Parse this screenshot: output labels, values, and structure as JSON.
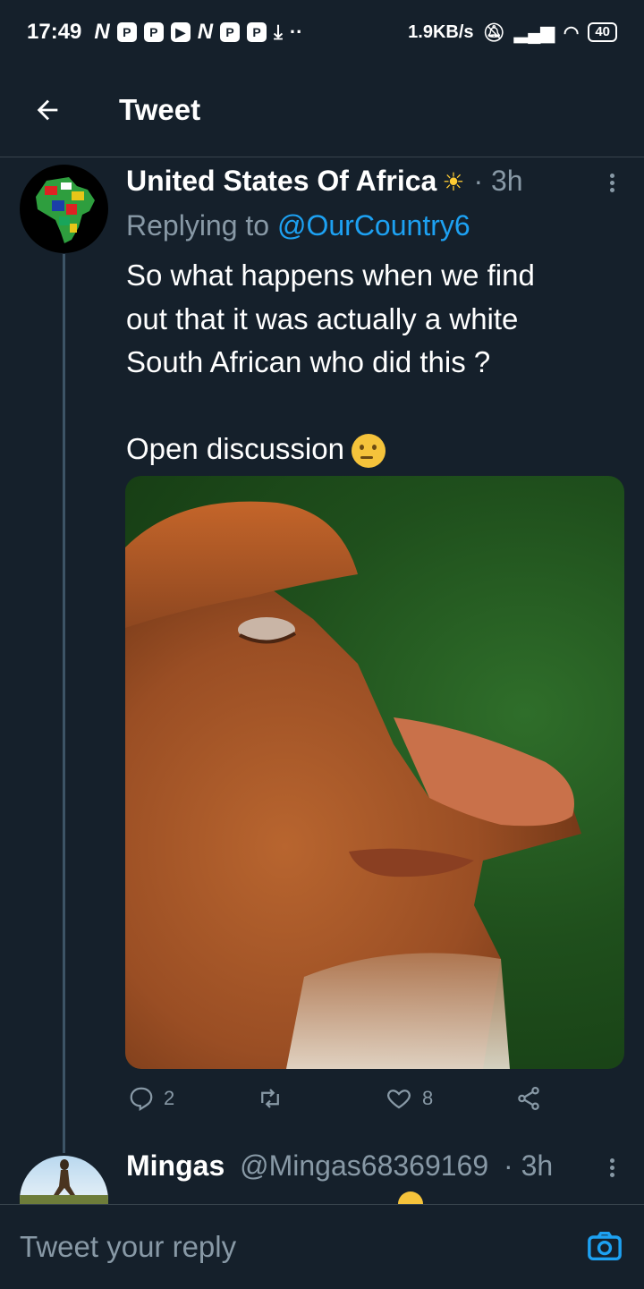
{
  "status_bar": {
    "time": "17:49",
    "network_speed": "1.9KB/s",
    "battery": "40",
    "dots": "··"
  },
  "header": {
    "title": "Tweet"
  },
  "tweet": {
    "author_name": "United States Of Africa",
    "author_emoji": "☀",
    "time": "· 3h",
    "replying_to_prefix": "Replying to ",
    "replying_to_handle": "@OurCountry6",
    "body_line1": "So what happens when we find",
    "body_line2": "out that it was actually a white",
    "body_line3": "South African who did this ?",
    "body_line4": "Open discussion",
    "reply_count": "2",
    "like_count": "8"
  },
  "next_tweet": {
    "author_name": "Mingas",
    "handle": "@Mingas68369169",
    "time": "· 3h"
  },
  "reply_bar": {
    "placeholder": "Tweet your reply"
  },
  "colors": {
    "background": "#15202b",
    "link": "#1da1f2",
    "muted": "#8899a6",
    "divider": "#38444d"
  }
}
